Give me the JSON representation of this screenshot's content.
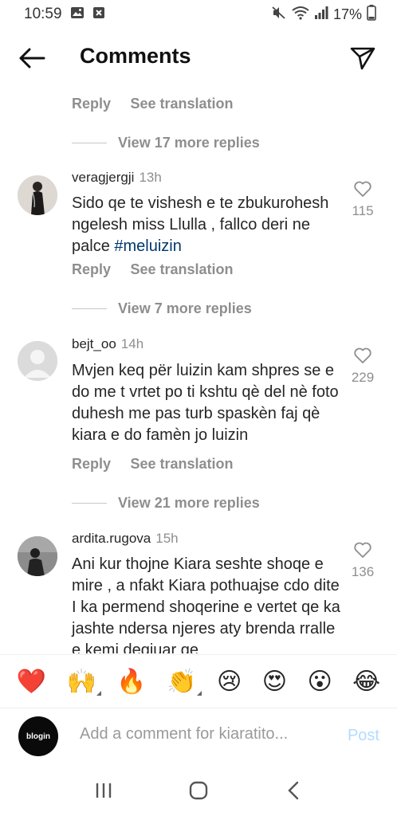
{
  "status": {
    "time": "10:59",
    "battery": "17%"
  },
  "header": {
    "title": "Comments"
  },
  "top_actions": {
    "reply": "Reply",
    "see_translation": "See translation",
    "view_more": "View 17 more replies"
  },
  "comments": [
    {
      "username": "veragjergji",
      "time": "13h",
      "text": "Sido qe te vishesh e te zbukurohesh ngelesh miss Llulla , fallco deri ne palce ",
      "hashtag": "#meluizin",
      "likes": "115",
      "reply": "Reply",
      "see_translation": "See translation",
      "view_more": "View 7 more replies"
    },
    {
      "username": "bejt_oo",
      "time": "14h",
      "text": "Mvjen keq për luizin kam shpres se e do me t vrtet po ti kshtu qè del nè foto duhesh me pas turb spaskèn faj qè kiara e do famèn jo luizin",
      "likes": "229",
      "reply": "Reply",
      "see_translation": "See translation",
      "view_more": "View 21 more replies"
    },
    {
      "username": "ardita.rugova",
      "time": "15h",
      "text": "Ani kur thojne Kiara seshte shoqe e mire , a nfakt Kiara pothuajse cdo dite I ka permend shoqerine e vertet qe ka jashte ndersa njeres aty brenda rralle e kemi degjuar qe",
      "likes": "136"
    }
  ],
  "emoji_bar": [
    {
      "glyph": "❤️",
      "name": "red-heart"
    },
    {
      "glyph": "🙌",
      "name": "raising-hands"
    },
    {
      "glyph": "🔥",
      "name": "fire"
    },
    {
      "glyph": "👏",
      "name": "clapping-hands"
    },
    {
      "glyph": "😢",
      "name": "crying-face"
    },
    {
      "glyph": "😍",
      "name": "heart-eyes"
    },
    {
      "glyph": "😮",
      "name": "face-open-mouth"
    },
    {
      "glyph": "😂",
      "name": "tears-of-joy"
    }
  ],
  "compose": {
    "avatar_text": "blogin",
    "placeholder": "Add a comment for kiaratito...",
    "post_label": "Post"
  },
  "colors": {
    "hashtag": "#00376b",
    "muted": "#8e8e8e",
    "post_disabled": "#b3dbff"
  }
}
